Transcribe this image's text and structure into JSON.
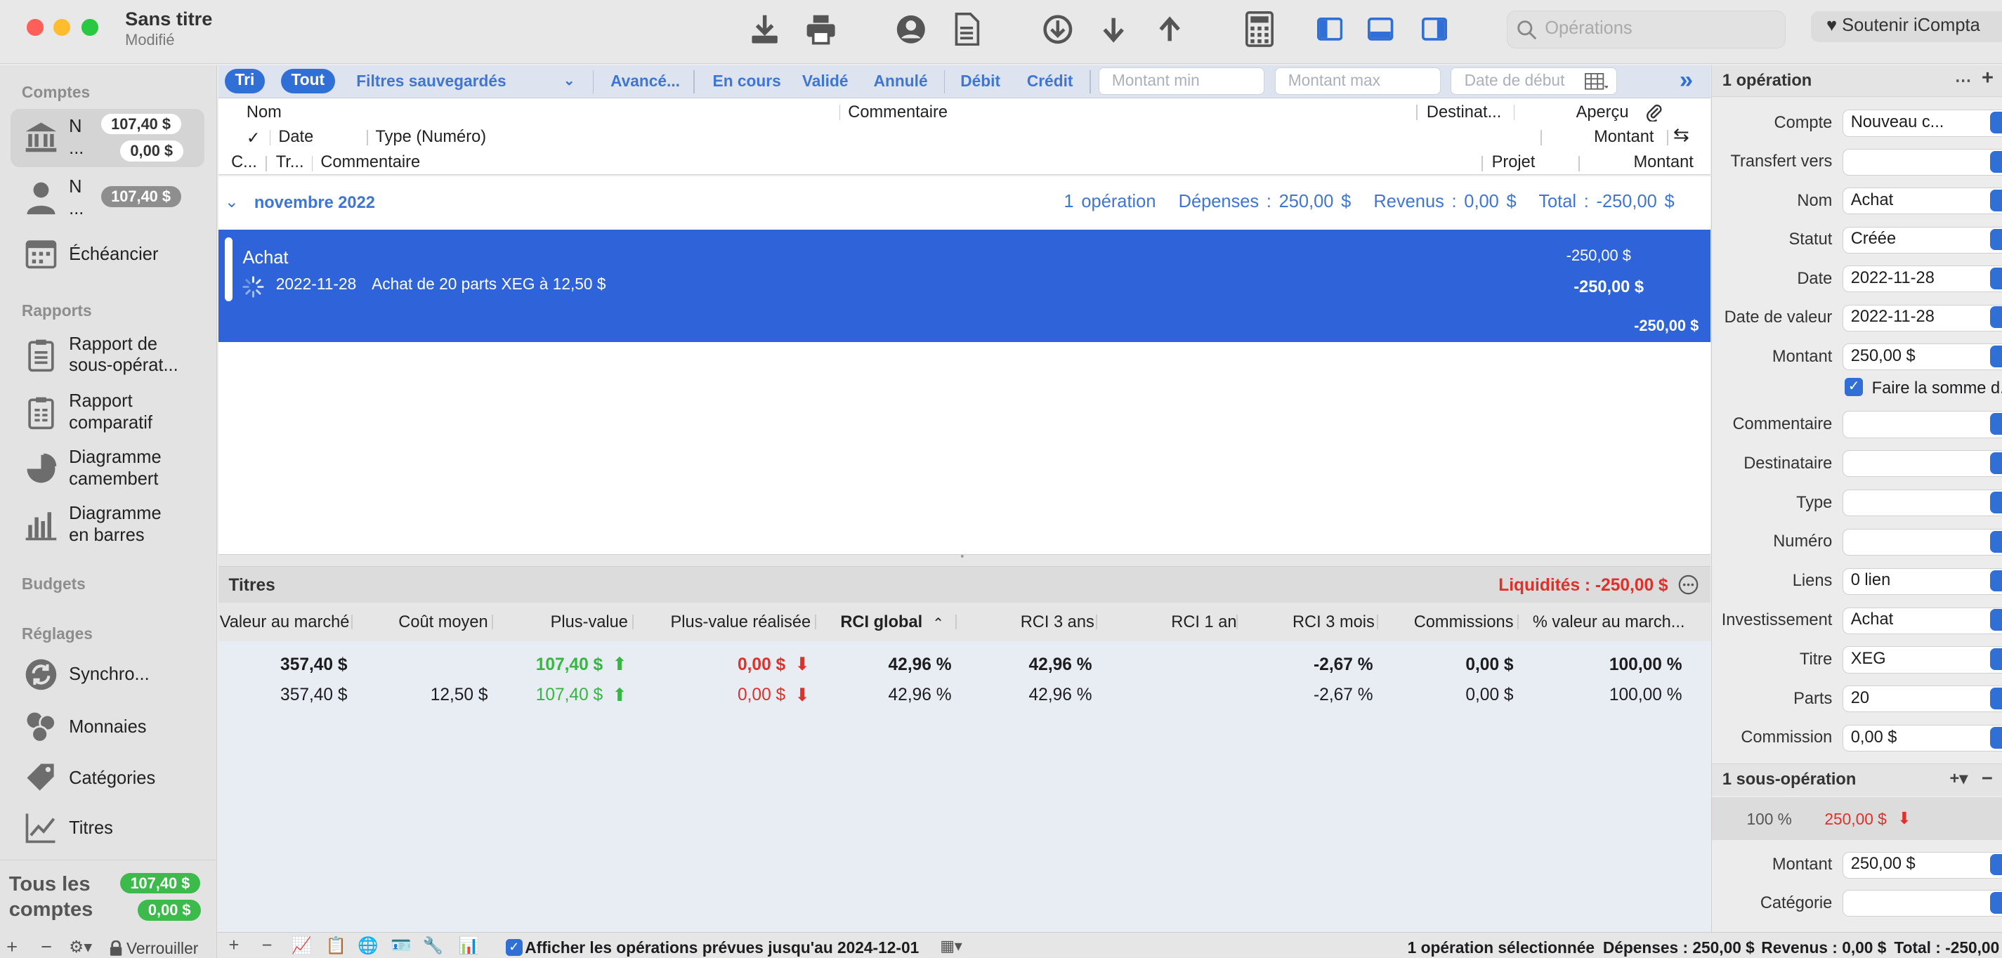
{
  "window": {
    "title": "Sans titre",
    "subtitle": "Modifié",
    "search_placeholder": "Opérations",
    "support_label": "♥ Soutenir iCompta"
  },
  "sidebar": {
    "section_accounts": "Comptes",
    "accounts": [
      {
        "name": "N\n...",
        "balance": "107,40 $",
        "pending": "0,00 $"
      },
      {
        "name": "N\n...",
        "balance": "107,40 $"
      }
    ],
    "scheduler": "Échéancier",
    "section_reports": "Rapports",
    "reports": [
      "Rapport de sous-opérat...",
      "Rapport comparatif",
      "Diagramme camembert",
      "Diagramme en barres"
    ],
    "section_budgets": "Budgets",
    "section_settings": "Réglages",
    "settings": [
      "Synchro...",
      "Monnaies",
      "Catégories",
      "Titres"
    ],
    "all_accounts": "Tous les comptes",
    "all_balance": "107,40 $",
    "all_pending": "0,00 $",
    "lock_label": "Verrouiller"
  },
  "filters": {
    "sort": "Tri",
    "all": "Tout",
    "saved": "Filtres sauvegardés",
    "advanced": "Avancé...",
    "in_progress": "En cours",
    "validated": "Validé",
    "cancelled": "Annulé",
    "debit": "Débit",
    "credit": "Crédit",
    "min_amount": "Montant min",
    "max_amount": "Montant max",
    "start_date": "Date de début"
  },
  "columns": {
    "name": "Nom",
    "comment": "Commentaire",
    "payee": "Destinat...",
    "preview": "Aperçu",
    "check": "✓",
    "date": "Date",
    "type_number": "Type (Numéro)",
    "amount": "Montant",
    "cat": "C...",
    "tr": "Tr...",
    "comment2": "Commentaire",
    "project": "Projet",
    "amount2": "Montant"
  },
  "group": {
    "title": "novembre 2022",
    "count": "1 opération",
    "expenses": "Dépenses : 250,00 $",
    "income": "Revenus : 0,00 $",
    "total": "Total : -250,00 $"
  },
  "transaction": {
    "name": "Achat",
    "date": "2022-11-28",
    "comment": "Achat de 20 parts XEG à 12,50 $",
    "amount1": "-250,00 $",
    "amount2": "-250,00 $",
    "amount3": "-250,00 $"
  },
  "securities": {
    "title": "Titres",
    "liquidity": "Liquidités : -250,00 $",
    "columns": [
      "Valeur au marché",
      "Coût moyen",
      "Plus-value",
      "Plus-value réalisée",
      "RCI global",
      "RCI 3 ans",
      "RCI 1 an",
      "RCI 3 mois",
      "Commissions",
      "% valeur au march..."
    ],
    "total_row": [
      "357,40 $",
      "",
      "107,40 $",
      "0,00 $",
      "42,96 %",
      "42,96 %",
      "",
      "-2,67 %",
      "0,00 $",
      "100,00 %"
    ],
    "row": [
      "357,40 $",
      "12,50 $",
      "107,40 $",
      "0,00 $",
      "42,96 %",
      "42,96 %",
      "",
      "-2,67 %",
      "0,00 $",
      "100,00 %"
    ]
  },
  "inspector": {
    "header": "1 opération",
    "fields": [
      {
        "label": "Compte",
        "value": "Nouveau c..."
      },
      {
        "label": "Transfert vers",
        "value": ""
      },
      {
        "label": "Nom",
        "value": "Achat"
      },
      {
        "label": "Statut",
        "value": "Créée"
      },
      {
        "label": "Date",
        "value": "2022-11-28"
      },
      {
        "label": "Date de valeur",
        "value": "2022-11-28"
      },
      {
        "label": "Montant",
        "value": "250,00 $"
      }
    ],
    "sum_checkbox": "Faire la somme d...",
    "fields2": [
      {
        "label": "Commentaire",
        "value": ""
      },
      {
        "label": "Destinataire",
        "value": ""
      },
      {
        "label": "Type",
        "value": ""
      },
      {
        "label": "Numéro",
        "value": ""
      },
      {
        "label": "Liens",
        "value": "0 lien"
      },
      {
        "label": "Investissement",
        "value": "Achat"
      },
      {
        "label": "Titre",
        "value": "XEG"
      },
      {
        "label": "Parts",
        "value": "20"
      },
      {
        "label": "Commission",
        "value": "0,00 $"
      }
    ],
    "split_header": "1 sous-opération",
    "split_percent": "100 %",
    "split_amount": "250,00 $",
    "split_fields": [
      {
        "label": "Montant",
        "value": "250,00 $"
      },
      {
        "label": "Catégorie",
        "value": ""
      }
    ]
  },
  "status": {
    "show_planned": "Afficher les opérations prévues jusqu'au 2024-12-01",
    "selected": "1 opération sélectionnée",
    "expenses": "Dépenses : 250,00 $",
    "income": "Revenus : 0,00 $",
    "total": "Total : -250,00"
  },
  "colors": {
    "accent": "#2f63d9",
    "positive": "#35b83f",
    "negative": "#e0302a"
  }
}
